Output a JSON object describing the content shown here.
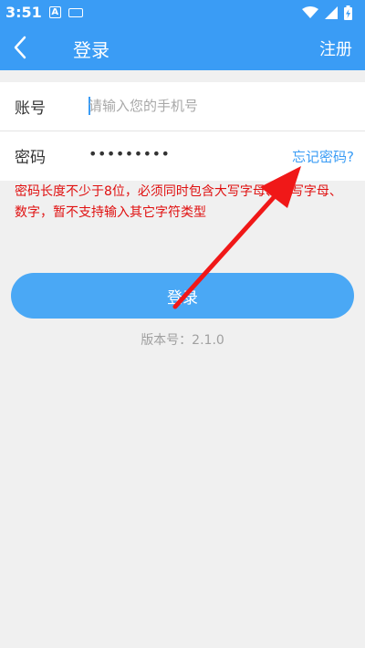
{
  "status_bar": {
    "time": "3:51",
    "notification_letter": "A"
  },
  "app_bar": {
    "title": "登录",
    "register_label": "注册"
  },
  "form": {
    "account": {
      "label": "账号",
      "placeholder": "请输入您的手机号",
      "value": ""
    },
    "password": {
      "label": "密码",
      "value": "•••••••••",
      "forgot_label": "忘记密码?"
    }
  },
  "hint": "密码长度不少于8位，必须同时包含大写字母、小写字母、数字，暂不支持输入其它字符类型",
  "login_button_label": "登录",
  "version": "版本号：2.1.0",
  "colors": {
    "primary": "#3a9cf5",
    "button": "#4aa8f5",
    "hint_red": "#e01010",
    "arrow_red": "#f01818"
  },
  "icons": [
    "back-arrow-icon",
    "wifi-icon",
    "signal-icon",
    "battery-charging-icon",
    "keyboard-icon"
  ]
}
